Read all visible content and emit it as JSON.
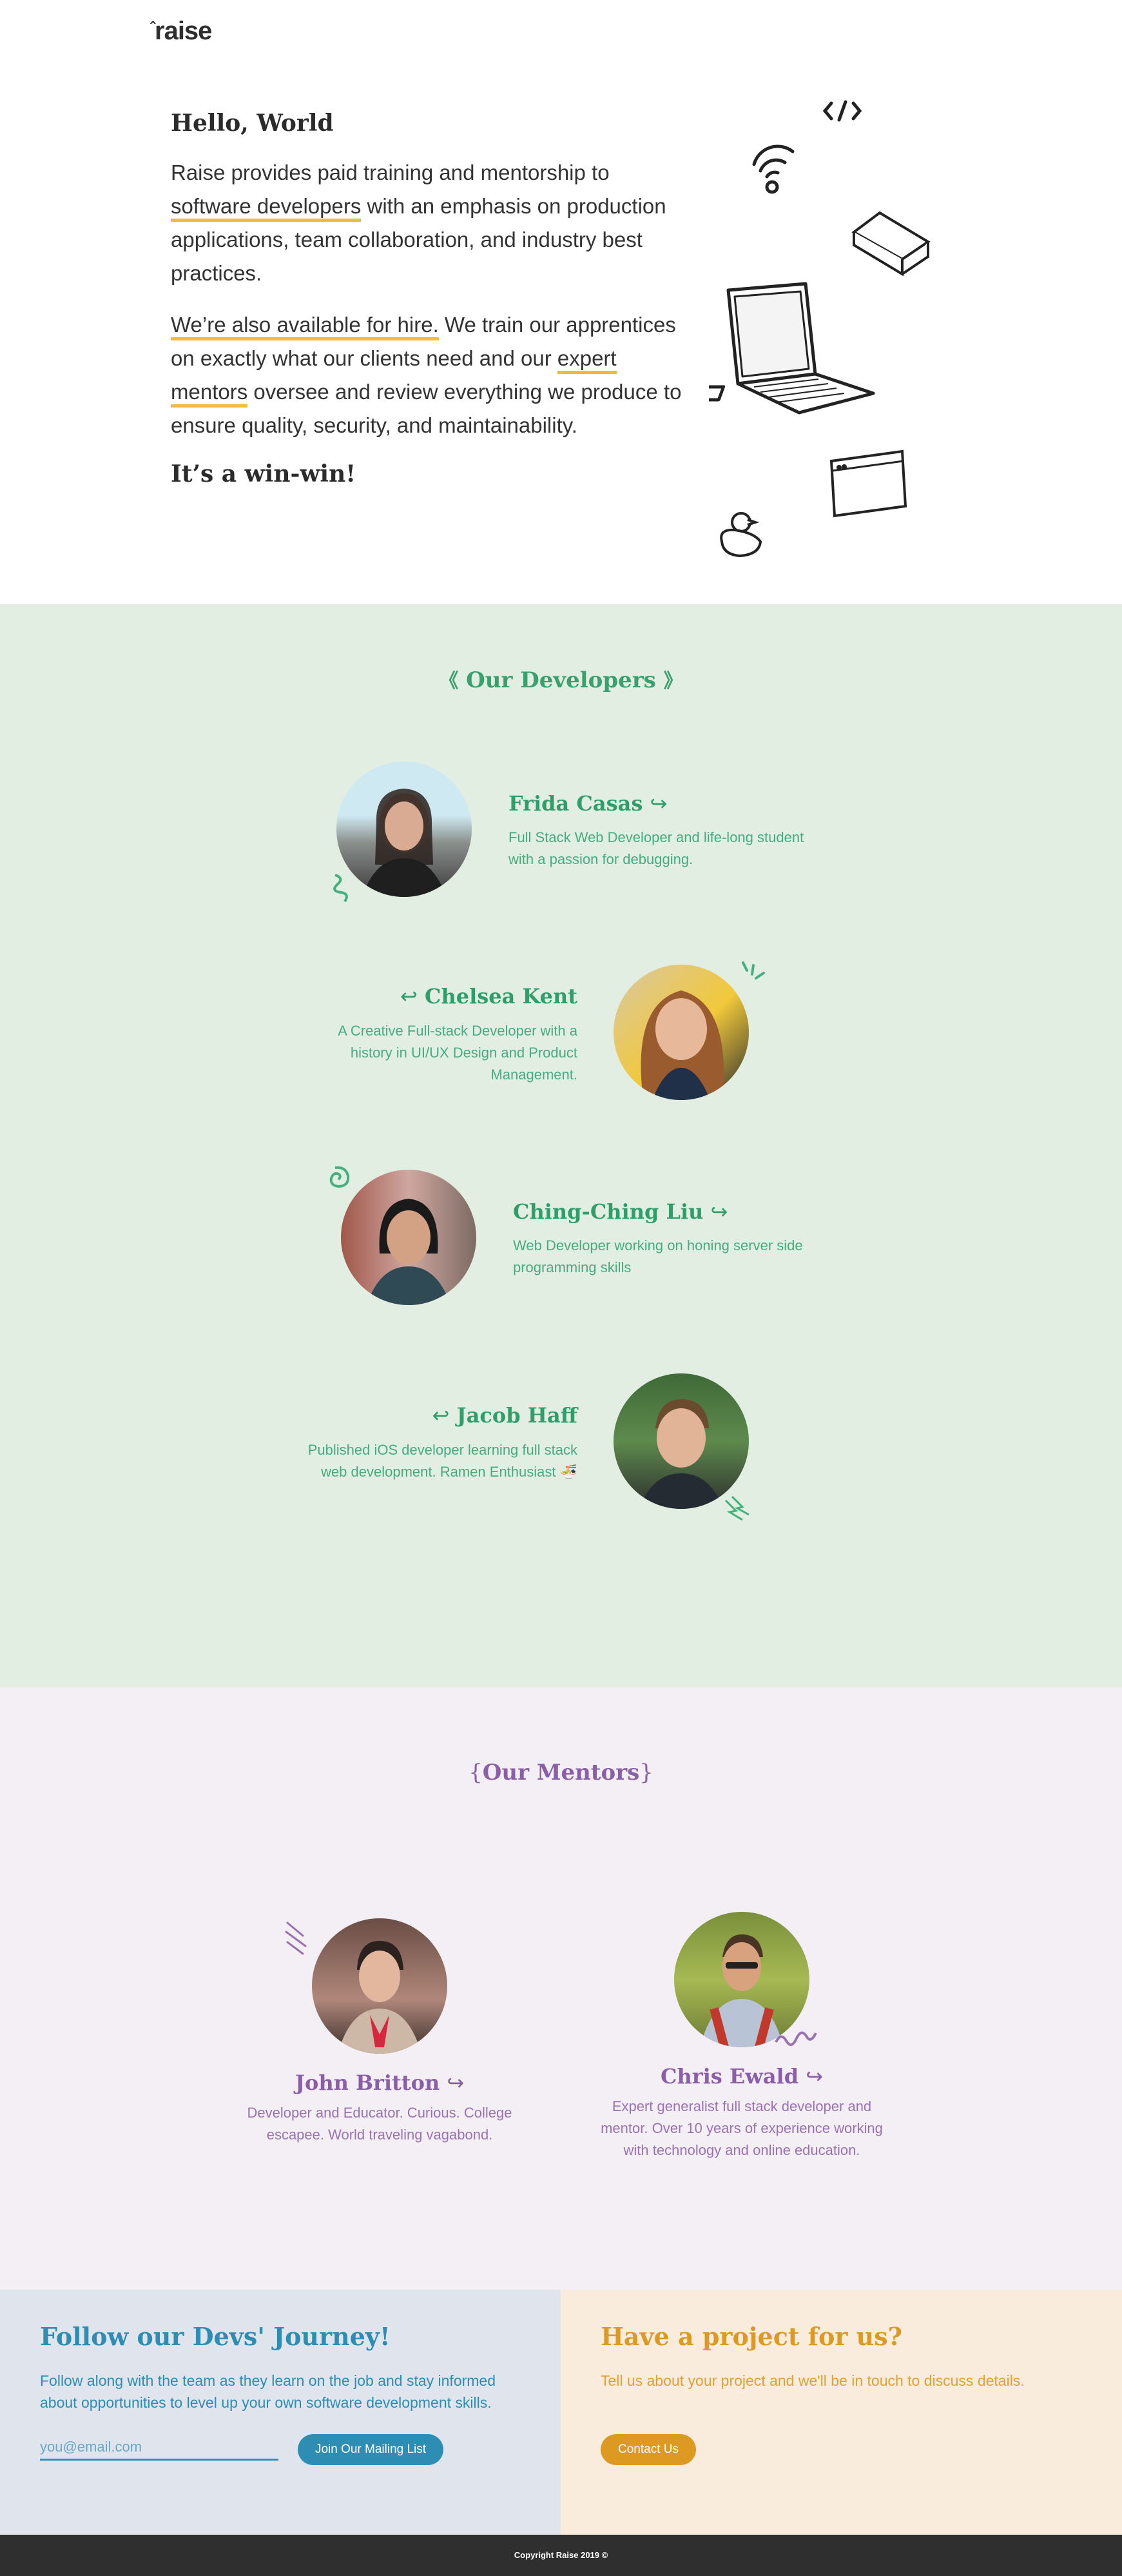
{
  "header": {
    "logo_caret": "ˆ",
    "logo_text": "raise"
  },
  "intro": {
    "heading": "Hello, World",
    "p1_pre": "Raise provides paid training and mentorship to ",
    "p1_link": "software developers",
    "p1_post": " with an emphasis on production applications, team collaboration, and industry best practices.",
    "p2_link1": "We’re also available for hire.",
    "p2_mid": " We train our apprentices on exactly what our clients need and our ",
    "p2_link2": "expert mentors",
    "p2_post": " oversee and review everything we produce to ensure quality, security, and maintainability.",
    "closing": "It’s a win-win!"
  },
  "developers": {
    "title": "Our Developers",
    "title_left": "《",
    "title_right": "》",
    "items": [
      {
        "name": "Frida Casas",
        "arrow": "↪",
        "desc": "Full Stack Web Developer and life-long student with a passion for debugging."
      },
      {
        "name": "Chelsea Kent",
        "arrow": "↩",
        "desc": "A Creative Full-stack Developer with a history in UI/UX Design and Product Management."
      },
      {
        "name": "Ching-Ching Liu",
        "arrow": "↪",
        "desc": "Web Developer working on honing server side programming skills"
      },
      {
        "name": "Jacob Haff",
        "arrow": "↩",
        "desc": "Published iOS developer learning full stack web development. Ramen Enthusiast 🍜"
      }
    ]
  },
  "mentors": {
    "title": "Our Mentors",
    "title_left": "{",
    "title_right": "}",
    "items": [
      {
        "name": "John Britton",
        "arrow": "↪",
        "desc": "Developer and Educator. Curious. College escapee. World traveling vagabond."
      },
      {
        "name": "Chris Ewald",
        "arrow": "↪",
        "desc": "Expert generalist full stack developer and mentor. Over 10 years of experience working with technology and online education."
      }
    ]
  },
  "follow": {
    "title": "Follow our Devs' Journey!",
    "text": "Follow along with the team as they learn on the job and stay informed about opportunities to level up your own software development skills.",
    "email_placeholder": "you@email.com",
    "button": "Join Our Mailing List"
  },
  "project": {
    "title": "Have a project for us?",
    "text": "Tell us about your project and we'll be in touch to discuss details.",
    "button": "Contact Us"
  },
  "footer": {
    "text": "Copyright Raise 2019 ©"
  },
  "colors": {
    "developers_bg": "#e1eee1",
    "developers_accent": "#2f9e6b",
    "mentors_bg": "#f3eff5",
    "mentors_accent": "#8b5ea8",
    "follow_bg": "#dfe4ed",
    "follow_accent": "#2e8db3",
    "project_bg": "#f9ecdd",
    "project_accent": "#dc9a22",
    "highlight": "#f5b93a",
    "footer_bg": "#2f2f2f"
  }
}
